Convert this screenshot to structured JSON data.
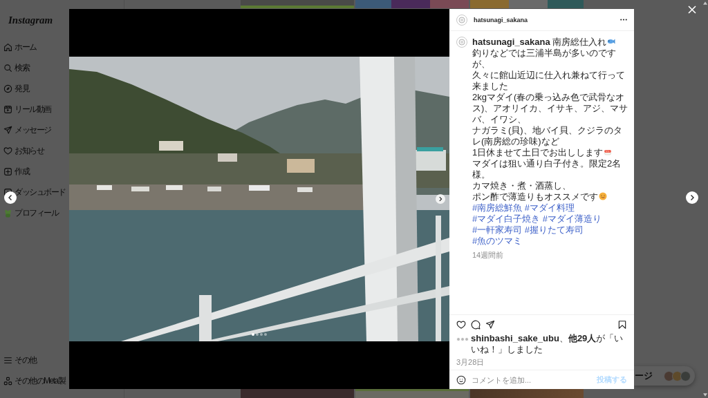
{
  "sidebar": {
    "logo": "Instagram",
    "items": [
      {
        "label": "ホーム",
        "kind": "home"
      },
      {
        "label": "検索",
        "kind": "search"
      },
      {
        "label": "発見",
        "kind": "compass"
      },
      {
        "label": "リール動画",
        "kind": "reels"
      },
      {
        "label": "メッセージ",
        "kind": "send"
      },
      {
        "label": "お知らせ",
        "kind": "heart"
      },
      {
        "label": "作成",
        "kind": "create"
      },
      {
        "label": "ダッシュボード",
        "kind": "dashboard"
      },
      {
        "label": "プロフィール",
        "kind": "profile"
      }
    ],
    "bottom_items": [
      {
        "label": "その他",
        "kind": "menu"
      },
      {
        "label": "その他のMeta製",
        "kind": "apps"
      }
    ]
  },
  "post": {
    "author": "hatsunagi_sakana",
    "carousel": {
      "dots": [
        {
          "selected": true
        },
        {
          "selected": false
        },
        {
          "selected": false
        },
        {
          "selected": false
        }
      ]
    },
    "caption": {
      "username": "hatsunagi_sakana",
      "title": "南房総仕入れ",
      "lines": [
        {
          "text": "釣りなどでは三浦半島が多いのですが、",
          "kind": "plain"
        },
        {
          "text": "久々に館山近辺に仕入れ兼ねて行って来ました",
          "kind": "plain"
        },
        {
          "text": "2kgマダイ(春の乗っ込み色で武骨なオス)、アオリイカ、イサキ、アジ、マサバ、イワシ、",
          "kind": "plain"
        },
        {
          "text": "ナガラミ(貝)、地バイ貝、クジラのタレ(南房総の珍味)など",
          "kind": "plain"
        },
        {
          "text": "1日休ませて土日でお出しします",
          "kind": "sushi"
        },
        {
          "text": "マダイは狙い通り白子付き。限定2名様。",
          "kind": "plain"
        },
        {
          "text": "カマ焼き・煮・酒蒸し、",
          "kind": "plain"
        },
        {
          "text": "ポン酢で薄造りもオススメです",
          "kind": "grin"
        }
      ],
      "hashtags": [
        "#南房総鮮魚",
        "#マダイ料理",
        "#マダイ白子焼き",
        "#マダイ薄造り",
        "#一軒家寿司",
        "#握りたて寿司",
        "#魚のツマミ"
      ],
      "time": "14週間前"
    },
    "likes": "**shinbashi_sake_ubu**、**他29人**が「いいね！」しました",
    "date": "3月28日",
    "comment": {
      "placeholder": "コメントを追加...",
      "submit": {
        "label": "投稿する",
        "disabled": true
      }
    }
  },
  "messages_pill": {
    "label": "ージ"
  }
}
